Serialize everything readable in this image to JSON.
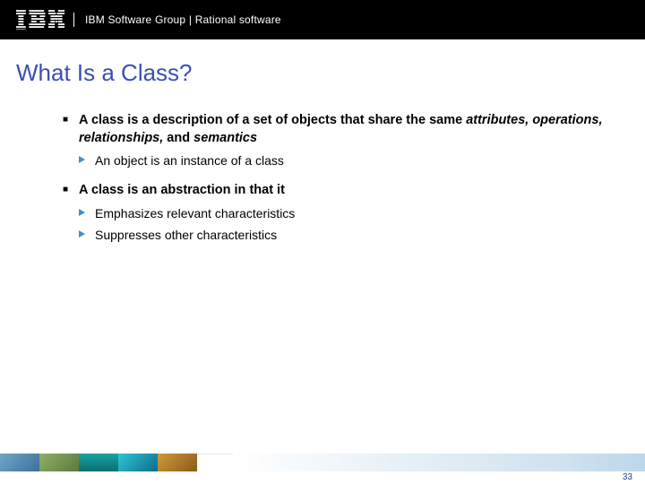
{
  "header": {
    "logo_alt": "IBM",
    "text": "IBM Software Group | Rational software"
  },
  "title": "What Is a Class?",
  "bullets": {
    "b1a_lead": "A class is a description of a set of objects that share the same ",
    "b1a_ital": "attributes, operations, relationships,",
    "b1a_and": " and ",
    "b1a_ital2": "semantics",
    "b1a_sub1": "An object is an instance of a class",
    "b1b": "A class is an abstraction in that it",
    "b1b_sub1": "Emphasizes relevant characteristics",
    "b1b_sub2": "Suppresses other characteristics"
  },
  "page_number": "33"
}
